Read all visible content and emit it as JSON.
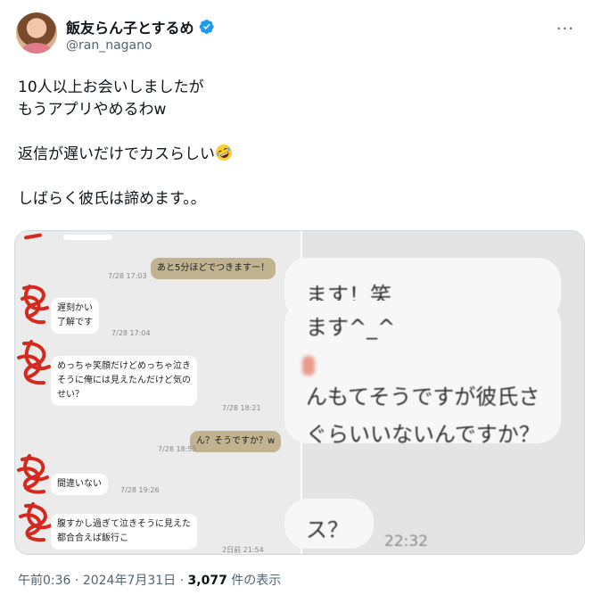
{
  "author": {
    "name": "飯友らん子とするめ",
    "handle": "@ran_nagano",
    "verified": true,
    "avatar": "avatar-photo"
  },
  "more_icon": "more-horizontal-icon",
  "tweet": {
    "line1": "10人以上お会いしましたが",
    "line2": "もうアプリやめるわw",
    "line3": "返信が遅いだけでカスらしい",
    "line3_emoji": "rolling-on-floor-laughing-emoji",
    "line4": "しばらく彼氏は諦めます。。"
  },
  "chat_left": {
    "messages": [
      {
        "side": "right",
        "text": "あと5分ほどでつきますー！",
        "time": "7/28 17:03"
      },
      {
        "side": "left",
        "text": "遅刻かい\n了解です",
        "time": "7/28 17:04"
      },
      {
        "side": "left",
        "text": "めっちゃ笑顔だけどめっちゃ泣き\nそうに俺には見えたんだけど気の\nせい？",
        "time": "7/28 18:21"
      },
      {
        "side": "right",
        "text": "ん？そうですか？w",
        "time": "7/28 18:55"
      },
      {
        "side": "left",
        "text": "間違いない",
        "time": "7/28 19:26"
      },
      {
        "side": "left",
        "text": "腹すかし過ぎて泣きそうに見えた\n都合合えば飯行こ",
        "time": "2日前 21:54"
      }
    ]
  },
  "chat_right": {
    "lines": [
      "ます！笑",
      "ます^_^",
      "んもてそうですが彼氏さ",
      "ぐらいいないんですか？",
      "ス？"
    ],
    "time": "22:32"
  },
  "meta": {
    "time": "午前0:36",
    "sep1": "·",
    "date": "2024年7月31日",
    "sep2": "·",
    "views": "3,077",
    "views_suffix": "件の表示"
  },
  "colors": {
    "text": "#0f1419",
    "secondary": "#536471",
    "verified": "#1d9bf0",
    "tan_bubble": "#c2b390",
    "scribble": "#d42a1e"
  }
}
